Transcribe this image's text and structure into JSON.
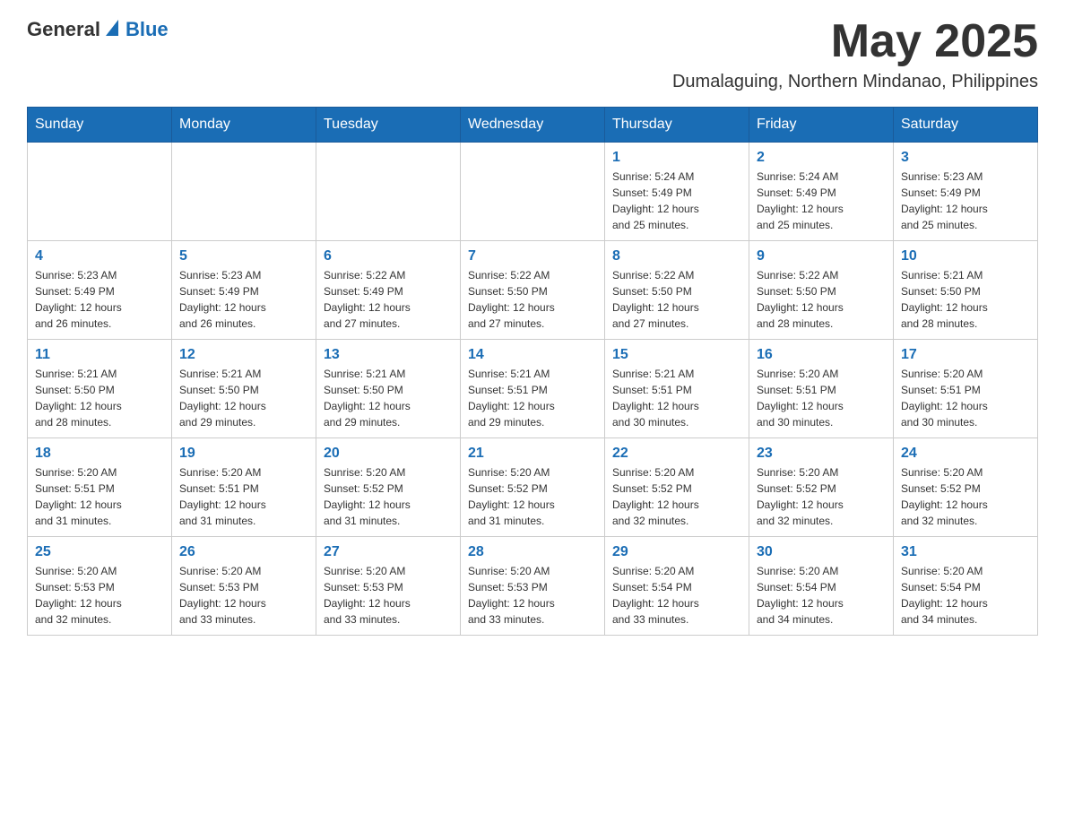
{
  "header": {
    "logo_general": "General",
    "logo_blue": "Blue",
    "month_title": "May 2025",
    "location": "Dumalaguing, Northern Mindanao, Philippines"
  },
  "weekdays": [
    "Sunday",
    "Monday",
    "Tuesday",
    "Wednesday",
    "Thursday",
    "Friday",
    "Saturday"
  ],
  "weeks": [
    [
      {
        "day": "",
        "info": ""
      },
      {
        "day": "",
        "info": ""
      },
      {
        "day": "",
        "info": ""
      },
      {
        "day": "",
        "info": ""
      },
      {
        "day": "1",
        "info": "Sunrise: 5:24 AM\nSunset: 5:49 PM\nDaylight: 12 hours\nand 25 minutes."
      },
      {
        "day": "2",
        "info": "Sunrise: 5:24 AM\nSunset: 5:49 PM\nDaylight: 12 hours\nand 25 minutes."
      },
      {
        "day": "3",
        "info": "Sunrise: 5:23 AM\nSunset: 5:49 PM\nDaylight: 12 hours\nand 25 minutes."
      }
    ],
    [
      {
        "day": "4",
        "info": "Sunrise: 5:23 AM\nSunset: 5:49 PM\nDaylight: 12 hours\nand 26 minutes."
      },
      {
        "day": "5",
        "info": "Sunrise: 5:23 AM\nSunset: 5:49 PM\nDaylight: 12 hours\nand 26 minutes."
      },
      {
        "day": "6",
        "info": "Sunrise: 5:22 AM\nSunset: 5:49 PM\nDaylight: 12 hours\nand 27 minutes."
      },
      {
        "day": "7",
        "info": "Sunrise: 5:22 AM\nSunset: 5:50 PM\nDaylight: 12 hours\nand 27 minutes."
      },
      {
        "day": "8",
        "info": "Sunrise: 5:22 AM\nSunset: 5:50 PM\nDaylight: 12 hours\nand 27 minutes."
      },
      {
        "day": "9",
        "info": "Sunrise: 5:22 AM\nSunset: 5:50 PM\nDaylight: 12 hours\nand 28 minutes."
      },
      {
        "day": "10",
        "info": "Sunrise: 5:21 AM\nSunset: 5:50 PM\nDaylight: 12 hours\nand 28 minutes."
      }
    ],
    [
      {
        "day": "11",
        "info": "Sunrise: 5:21 AM\nSunset: 5:50 PM\nDaylight: 12 hours\nand 28 minutes."
      },
      {
        "day": "12",
        "info": "Sunrise: 5:21 AM\nSunset: 5:50 PM\nDaylight: 12 hours\nand 29 minutes."
      },
      {
        "day": "13",
        "info": "Sunrise: 5:21 AM\nSunset: 5:50 PM\nDaylight: 12 hours\nand 29 minutes."
      },
      {
        "day": "14",
        "info": "Sunrise: 5:21 AM\nSunset: 5:51 PM\nDaylight: 12 hours\nand 29 minutes."
      },
      {
        "day": "15",
        "info": "Sunrise: 5:21 AM\nSunset: 5:51 PM\nDaylight: 12 hours\nand 30 minutes."
      },
      {
        "day": "16",
        "info": "Sunrise: 5:20 AM\nSunset: 5:51 PM\nDaylight: 12 hours\nand 30 minutes."
      },
      {
        "day": "17",
        "info": "Sunrise: 5:20 AM\nSunset: 5:51 PM\nDaylight: 12 hours\nand 30 minutes."
      }
    ],
    [
      {
        "day": "18",
        "info": "Sunrise: 5:20 AM\nSunset: 5:51 PM\nDaylight: 12 hours\nand 31 minutes."
      },
      {
        "day": "19",
        "info": "Sunrise: 5:20 AM\nSunset: 5:51 PM\nDaylight: 12 hours\nand 31 minutes."
      },
      {
        "day": "20",
        "info": "Sunrise: 5:20 AM\nSunset: 5:52 PM\nDaylight: 12 hours\nand 31 minutes."
      },
      {
        "day": "21",
        "info": "Sunrise: 5:20 AM\nSunset: 5:52 PM\nDaylight: 12 hours\nand 31 minutes."
      },
      {
        "day": "22",
        "info": "Sunrise: 5:20 AM\nSunset: 5:52 PM\nDaylight: 12 hours\nand 32 minutes."
      },
      {
        "day": "23",
        "info": "Sunrise: 5:20 AM\nSunset: 5:52 PM\nDaylight: 12 hours\nand 32 minutes."
      },
      {
        "day": "24",
        "info": "Sunrise: 5:20 AM\nSunset: 5:52 PM\nDaylight: 12 hours\nand 32 minutes."
      }
    ],
    [
      {
        "day": "25",
        "info": "Sunrise: 5:20 AM\nSunset: 5:53 PM\nDaylight: 12 hours\nand 32 minutes."
      },
      {
        "day": "26",
        "info": "Sunrise: 5:20 AM\nSunset: 5:53 PM\nDaylight: 12 hours\nand 33 minutes."
      },
      {
        "day": "27",
        "info": "Sunrise: 5:20 AM\nSunset: 5:53 PM\nDaylight: 12 hours\nand 33 minutes."
      },
      {
        "day": "28",
        "info": "Sunrise: 5:20 AM\nSunset: 5:53 PM\nDaylight: 12 hours\nand 33 minutes."
      },
      {
        "day": "29",
        "info": "Sunrise: 5:20 AM\nSunset: 5:54 PM\nDaylight: 12 hours\nand 33 minutes."
      },
      {
        "day": "30",
        "info": "Sunrise: 5:20 AM\nSunset: 5:54 PM\nDaylight: 12 hours\nand 34 minutes."
      },
      {
        "day": "31",
        "info": "Sunrise: 5:20 AM\nSunset: 5:54 PM\nDaylight: 12 hours\nand 34 minutes."
      }
    ]
  ]
}
